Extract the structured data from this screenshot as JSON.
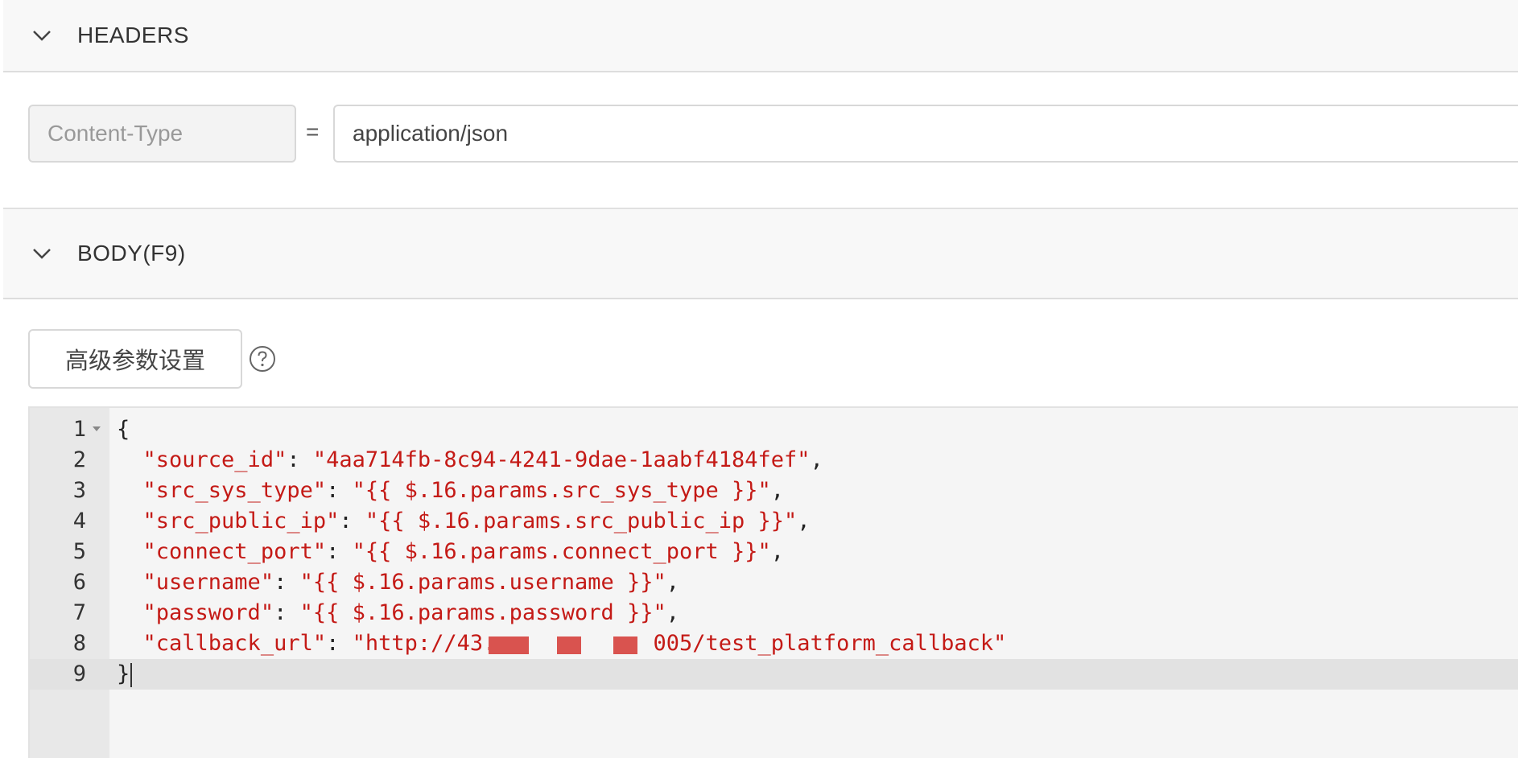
{
  "headers_section": {
    "title": "HEADERS"
  },
  "header_row": {
    "key": "Content-Type",
    "separator": "=",
    "value": "application/json"
  },
  "body_section": {
    "title": "BODY(F9)"
  },
  "advanced_button": {
    "label": "高级参数设置"
  },
  "editor": {
    "lines": [
      {
        "num": "1",
        "parts": [
          {
            "t": "{",
            "c": "p"
          }
        ]
      },
      {
        "num": "2",
        "parts": [
          {
            "t": "  ",
            "c": "p"
          },
          {
            "t": "\"source_id\"",
            "c": "s"
          },
          {
            "t": ": ",
            "c": "p"
          },
          {
            "t": "\"4aa714fb-8c94-4241-9dae-1aabf4184fef\"",
            "c": "s"
          },
          {
            "t": ",",
            "c": "p"
          }
        ]
      },
      {
        "num": "3",
        "parts": [
          {
            "t": "  ",
            "c": "p"
          },
          {
            "t": "\"src_sys_type\"",
            "c": "s"
          },
          {
            "t": ": ",
            "c": "p"
          },
          {
            "t": "\"{{ $.16.params.src_sys_type }}\"",
            "c": "s"
          },
          {
            "t": ",",
            "c": "p"
          }
        ]
      },
      {
        "num": "4",
        "parts": [
          {
            "t": "  ",
            "c": "p"
          },
          {
            "t": "\"src_public_ip\"",
            "c": "s"
          },
          {
            "t": ": ",
            "c": "p"
          },
          {
            "t": "\"{{ $.16.params.src_public_ip }}\"",
            "c": "s"
          },
          {
            "t": ",",
            "c": "p"
          }
        ]
      },
      {
        "num": "5",
        "parts": [
          {
            "t": "  ",
            "c": "p"
          },
          {
            "t": "\"connect_port\"",
            "c": "s"
          },
          {
            "t": ": ",
            "c": "p"
          },
          {
            "t": "\"{{ $.16.params.connect_port }}\"",
            "c": "s"
          },
          {
            "t": ",",
            "c": "p"
          }
        ]
      },
      {
        "num": "6",
        "parts": [
          {
            "t": "  ",
            "c": "p"
          },
          {
            "t": "\"username\"",
            "c": "s"
          },
          {
            "t": ": ",
            "c": "p"
          },
          {
            "t": "\"{{ $.16.params.username }}\"",
            "c": "s"
          },
          {
            "t": ",",
            "c": "p"
          }
        ]
      },
      {
        "num": "7",
        "parts": [
          {
            "t": "  ",
            "c": "p"
          },
          {
            "t": "\"password\"",
            "c": "s"
          },
          {
            "t": ": ",
            "c": "p"
          },
          {
            "t": "\"{{ $.16.params.password }}\"",
            "c": "s"
          },
          {
            "t": ",",
            "c": "p"
          }
        ]
      },
      {
        "num": "8",
        "parts": [
          {
            "t": "  ",
            "c": "p"
          },
          {
            "t": "\"callback_url\"",
            "c": "s"
          },
          {
            "t": ": ",
            "c": "p"
          },
          {
            "t": "\"http://43.",
            "c": "s"
          },
          {
            "t": "            ",
            "c": "p"
          },
          {
            "t": "005/test_platform_callback\"",
            "c": "s"
          }
        ]
      },
      {
        "num": "9",
        "parts": [
          {
            "t": "}",
            "c": "p"
          }
        ]
      }
    ],
    "active_line": 9,
    "fold_line": 1
  },
  "colors": {
    "string": "#c41a16",
    "punctuation": "#222222",
    "gutter": "#e8e8e8",
    "editor_bg": "#f5f5f5"
  }
}
